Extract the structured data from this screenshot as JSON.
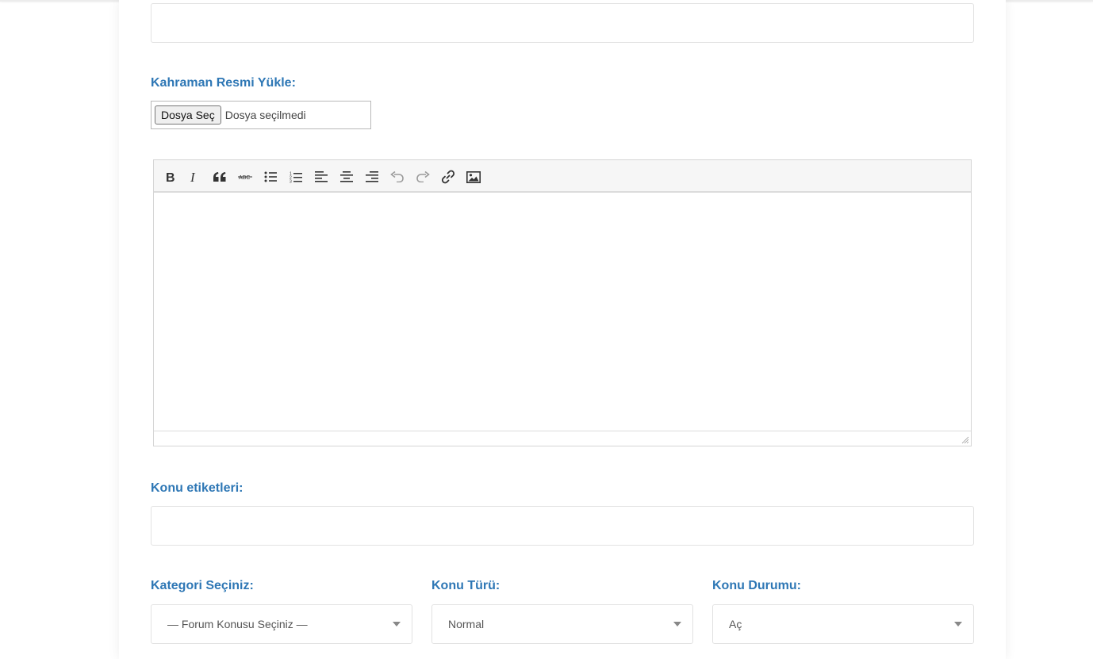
{
  "hero_image": {
    "label": "Kahraman Resmi Yükle:",
    "button_label": "Dosya Seç",
    "status": "Dosya seçilmedi"
  },
  "editor": {
    "toolbar": [
      {
        "name": "bold-button",
        "icon": "bold-icon"
      },
      {
        "name": "italic-button",
        "icon": "italic-icon"
      },
      {
        "name": "blockquote-button",
        "icon": "quote-icon"
      },
      {
        "name": "strikethrough-button",
        "icon": "strikethrough-icon"
      },
      {
        "name": "bullet-list-button",
        "icon": "bullet-list-icon"
      },
      {
        "name": "numbered-list-button",
        "icon": "numbered-list-icon"
      },
      {
        "name": "align-left-button",
        "icon": "align-left-icon"
      },
      {
        "name": "align-center-button",
        "icon": "align-center-icon"
      },
      {
        "name": "align-right-button",
        "icon": "align-right-icon"
      },
      {
        "name": "undo-button",
        "icon": "undo-icon"
      },
      {
        "name": "redo-button",
        "icon": "redo-icon"
      },
      {
        "name": "insert-link-button",
        "icon": "link-icon"
      },
      {
        "name": "insert-image-button",
        "icon": "image-icon"
      }
    ],
    "content": ""
  },
  "tags": {
    "label": "Konu etiketleri:",
    "value": ""
  },
  "category": {
    "label": "Kategori Seçiniz:",
    "selected": "— Forum Konusu Seçiniz —"
  },
  "topic_type": {
    "label": "Konu Türü:",
    "selected": "Normal"
  },
  "topic_status": {
    "label": "Konu Durumu:",
    "selected": "Aç"
  },
  "colors": {
    "label": "#2e77b5",
    "border": "#e2e2e2"
  }
}
